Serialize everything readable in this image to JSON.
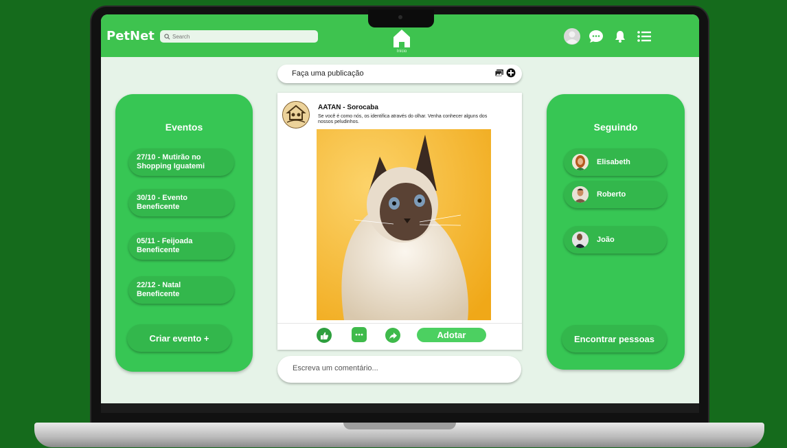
{
  "header": {
    "logo": "PetNet",
    "search_placeholder": "Search",
    "home_label": "Início"
  },
  "publish": {
    "placeholder": "Faça uma publicação"
  },
  "events": {
    "title": "Eventos",
    "items": [
      "27/10 - Mutirão no Shopping Iguatemi",
      "30/10 - Evento Beneficente",
      "05/11 - Feijoada Beneficente",
      "22/12 - Natal Beneficente"
    ],
    "create_label": "Criar evento +"
  },
  "post": {
    "author": "AATAN - Sorocaba",
    "text": "Se você é como nós, os identifica através do olhar. Venha conhecer alguns dos nossos peludinhos.",
    "adopt_label": "Adotar"
  },
  "comment": {
    "placeholder": "Escreva um comentário..."
  },
  "following": {
    "title": "Seguindo",
    "people": [
      "Elisabeth",
      "Roberto",
      "João"
    ],
    "find_label": "Encontrar pessoas"
  },
  "colors": {
    "background": "#156b1c",
    "brand_green": "#3ec34f",
    "panel_green": "#37c654",
    "action_green": "#2e9f3e",
    "screen_bg": "#e6f3e8"
  },
  "icons": [
    "search-icon",
    "home-icon",
    "profile-icon",
    "chat-icon",
    "bell-icon",
    "menu-icon",
    "image-icon",
    "add-icon",
    "like-icon",
    "comment-icon",
    "share-icon"
  ]
}
